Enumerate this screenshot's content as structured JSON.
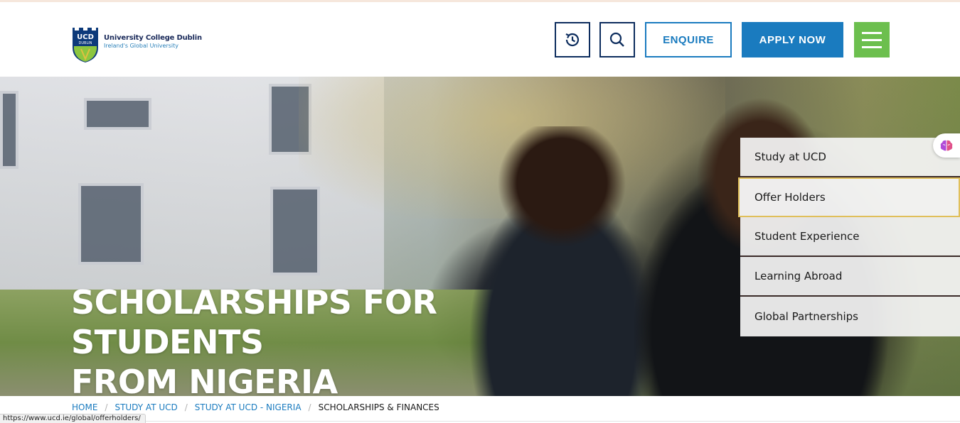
{
  "header": {
    "logo_name": "University College Dublin",
    "logo_tagline": "Ireland's Global University",
    "crest_text_top": "UCD",
    "crest_text_bottom": "DUBLIN",
    "history_icon": "history-icon",
    "search_icon": "search-icon",
    "enquire_label": "ENQUIRE",
    "apply_label": "APPLY NOW",
    "menu_icon": "hamburger-menu-icon"
  },
  "hero": {
    "title_line1": "SCHOLARSHIPS FOR STUDENTS",
    "title_line2": "FROM NIGERIA"
  },
  "side_nav": {
    "items": [
      {
        "label": "Study at UCD"
      },
      {
        "label": "Offer Holders"
      },
      {
        "label": "Student Experience"
      },
      {
        "label": "Learning Abroad"
      },
      {
        "label": "Global Partnerships"
      }
    ],
    "active_index": 1
  },
  "breadcrumb": {
    "items": [
      {
        "label": "HOME"
      },
      {
        "label": "STUDY AT UCD"
      },
      {
        "label": "STUDY AT UCD - NIGERIA"
      },
      {
        "label": "SCHOLARSHIPS & FINANCES"
      }
    ],
    "separator": "/"
  },
  "status_bar": {
    "url": "https://www.ucd.ie/global/offerholders/"
  },
  "floating_extension": {
    "icon": "brain-icon"
  },
  "colors": {
    "navy": "#0d2d5e",
    "blue": "#1a7bbf",
    "green": "#6cbf4e",
    "active_border": "#e0bf5a"
  }
}
